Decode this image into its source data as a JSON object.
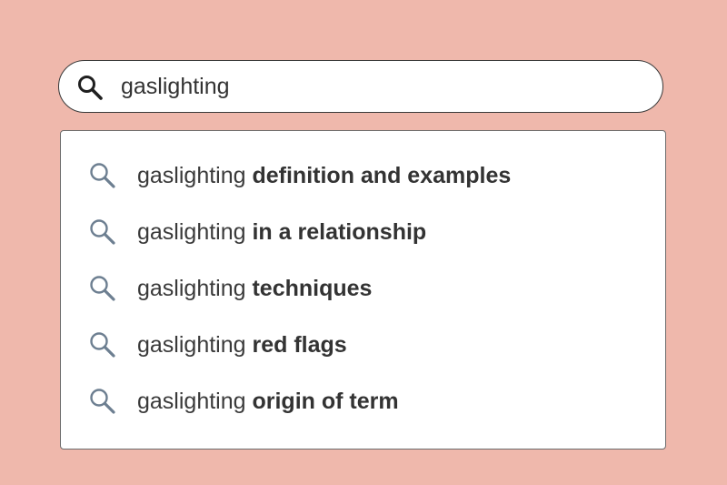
{
  "search": {
    "query": "gaslighting",
    "icon": "search-icon"
  },
  "suggestions": [
    {
      "prefix": "gaslighting",
      "completion": "definition and examples",
      "icon": "search-icon"
    },
    {
      "prefix": "gaslighting",
      "completion": "in a relationship",
      "icon": "search-icon"
    },
    {
      "prefix": "gaslighting",
      "completion": "techniques",
      "icon": "search-icon"
    },
    {
      "prefix": "gaslighting",
      "completion": "red flags",
      "icon": "search-icon"
    },
    {
      "prefix": "gaslighting",
      "completion": "origin of term",
      "icon": "search-icon"
    }
  ],
  "colors": {
    "background": "#efb8ac",
    "panel": "#ffffff",
    "border": "#3a3a3a",
    "suggestion_icon": "#6d7f91",
    "text": "#333333"
  }
}
